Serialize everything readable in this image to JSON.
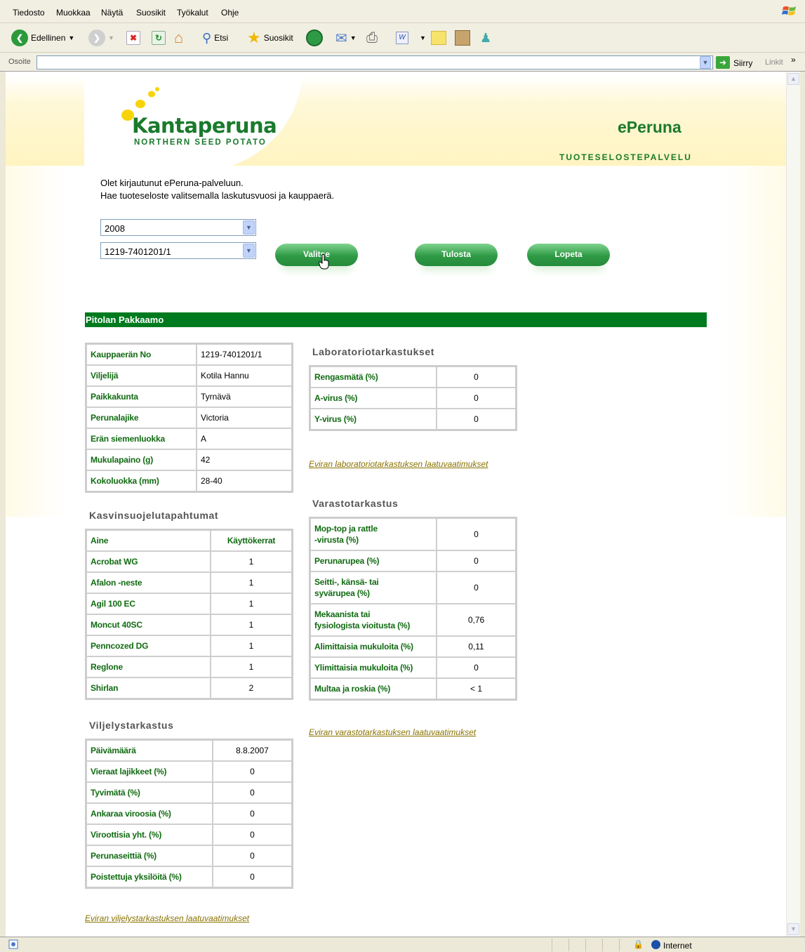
{
  "menu": [
    "Tiedosto",
    "Muokkaa",
    "Näytä",
    "Suosikit",
    "Työkalut",
    "Ohje"
  ],
  "toolbar": {
    "back_label": "Edellinen",
    "search_label": "Etsi",
    "favorites_label": "Suosikit"
  },
  "address": {
    "label": "Osoite",
    "value": "",
    "go_label": "Siirry",
    "links_label": "Linkit"
  },
  "status": {
    "zone": "Internet"
  },
  "header": {
    "logo_name": "Kantaperuna",
    "logo_sub": "NORTHERN SEED POTATO",
    "service_name": "ePeruna",
    "service_sub": "TUOTESELOSTEPALVELU"
  },
  "intro": {
    "line1": "Olet kirjautunut ePeruna-palveluun.",
    "line2": "Hae tuoteseloste valitsemalla laskutusvuosi ja kauppaerä."
  },
  "selects": {
    "year": "2008",
    "lot": "1219-7401201/1"
  },
  "buttons": {
    "select": "Valitse",
    "print": "Tulosta",
    "quit": "Lopeta"
  },
  "company": "Pitolan Pakkaamo",
  "lot_info": [
    {
      "label": "Kauppaerän No",
      "value": "1219-7401201/1"
    },
    {
      "label": "Viljelijä",
      "value": "Kotila Hannu"
    },
    {
      "label": "Paikkakunta",
      "value": "Tyrnävä"
    },
    {
      "label": "Perunalajike",
      "value": "Victoria"
    },
    {
      "label": "Erän siemenluokka",
      "value": "A"
    },
    {
      "label": "Mukulapaino (g)",
      "value": "42"
    },
    {
      "label": "Kokoluokka (mm)",
      "value": "28-40"
    }
  ],
  "plant_protection": {
    "title": "Kasvinsuojelutapahtumat",
    "headers": [
      "Aine",
      "Käyttökerrat"
    ],
    "rows": [
      [
        "Acrobat WG",
        "1"
      ],
      [
        "Afalon -neste",
        "1"
      ],
      [
        "Agil 100 EC",
        "1"
      ],
      [
        "Moncut 40SC",
        "1"
      ],
      [
        "Penncozed DG",
        "1"
      ],
      [
        "Reglone",
        "1"
      ],
      [
        "Shirlan",
        "2"
      ]
    ]
  },
  "field_inspection": {
    "title": "Viljelystarkastus",
    "rows": [
      [
        "Päivämäärä",
        "8.8.2007"
      ],
      [
        "Vieraat lajikkeet (%)",
        "0"
      ],
      [
        "Tyvimätä (%)",
        "0"
      ],
      [
        "Ankaraa viroosia (%)",
        "0"
      ],
      [
        "Viroottisia yht. (%)",
        "0"
      ],
      [
        "Perunaseittiä (%)",
        "0"
      ],
      [
        "Poistettuja yksilöitä (%)",
        "0"
      ]
    ],
    "link": "Eviran viljelystarkastuksen laatuvaatimukset"
  },
  "lab_inspection": {
    "title": "Laboratoriotarkastukset",
    "rows": [
      [
        "Rengasmätä (%)",
        "0"
      ],
      [
        "A-virus (%)",
        "0"
      ],
      [
        "Y-virus (%)",
        "0"
      ]
    ],
    "link": "Eviran laboratoriotarkastuksen laatuvaatimukset"
  },
  "storage_inspection": {
    "title": "Varastotarkastus",
    "rows": [
      [
        "Mop-top ja rattle\n-virusta (%)",
        "0"
      ],
      [
        "Perunarupea (%)",
        "0"
      ],
      [
        "Seitti-, känsä- tai\nsyvärupea (%)",
        "0"
      ],
      [
        "Mekaanista tai\nfysiologista vioitusta (%)",
        "0,76"
      ],
      [
        "Alimittaisia mukuloita (%)",
        "0,11"
      ],
      [
        "Ylimittaisia mukuloita (%)",
        "0"
      ],
      [
        "Multaa ja roskia (%)",
        "< 1"
      ]
    ],
    "link": "Eviran varastotarkastuksen laatuvaatimukset"
  },
  "colors": {
    "brand_green": "#007a1e",
    "label_green": "#116b12",
    "link_olive": "#8a7200"
  }
}
